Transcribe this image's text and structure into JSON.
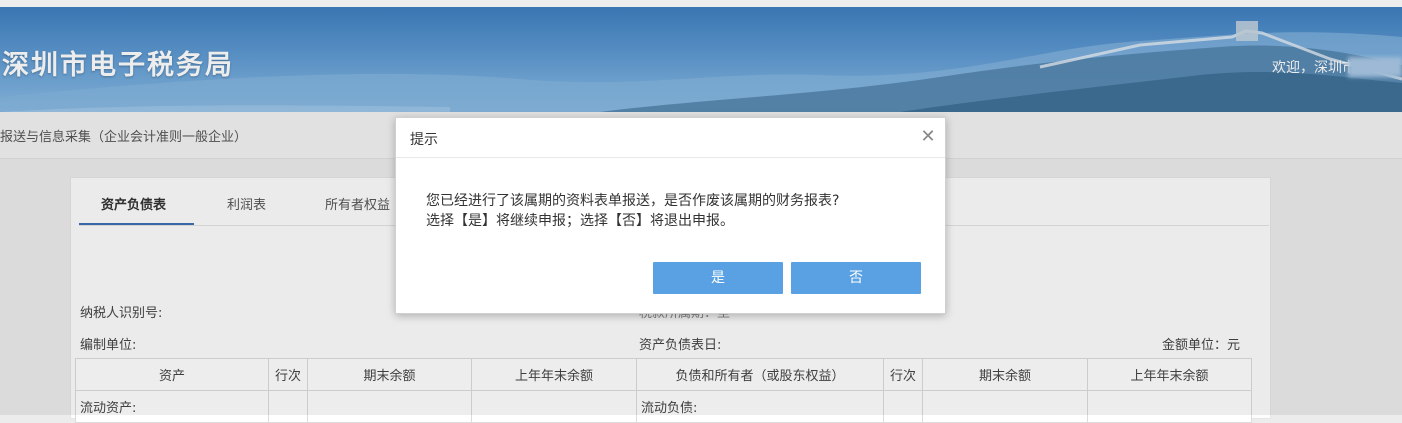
{
  "header": {
    "site_title": "深圳市电子税务局",
    "welcome_text": "欢迎，深圳市"
  },
  "subheader": {
    "title": "报送与信息采集（企业会计准则一般企业）"
  },
  "tabs": [
    {
      "label": "资产负债表",
      "active": true
    },
    {
      "label": "利润表",
      "active": false
    },
    {
      "label": "所有者权益",
      "active": false
    }
  ],
  "info": {
    "taxpayer_id_label": "纳税人识别号:",
    "period_label": "税款所属期：至",
    "compiler_label": "编制单位:",
    "sheet_date_label": "资产负债表日:",
    "currency_label": "金额单位：元"
  },
  "table": {
    "headers": [
      "资产",
      "行次",
      "期末余额",
      "上年年末余额",
      "负债和所有者（或股东权益）",
      "行次",
      "期末余额",
      "上年年末余额"
    ],
    "row1": {
      "left": "流动资产:",
      "right": "流动负债:"
    }
  },
  "dialog": {
    "title": "提示",
    "message_line1": "您已经进行了该属期的资料表单报送，是否作废该属期的财务报表?",
    "message_line2": "选择【是】将继续申报；选择【否】将退出申报。",
    "yes_label": "是",
    "no_label": "否"
  },
  "colors": {
    "banner": "#5e9ad2",
    "button": "#5aa1e3",
    "tab_active_underline": "#3d6fb5"
  }
}
